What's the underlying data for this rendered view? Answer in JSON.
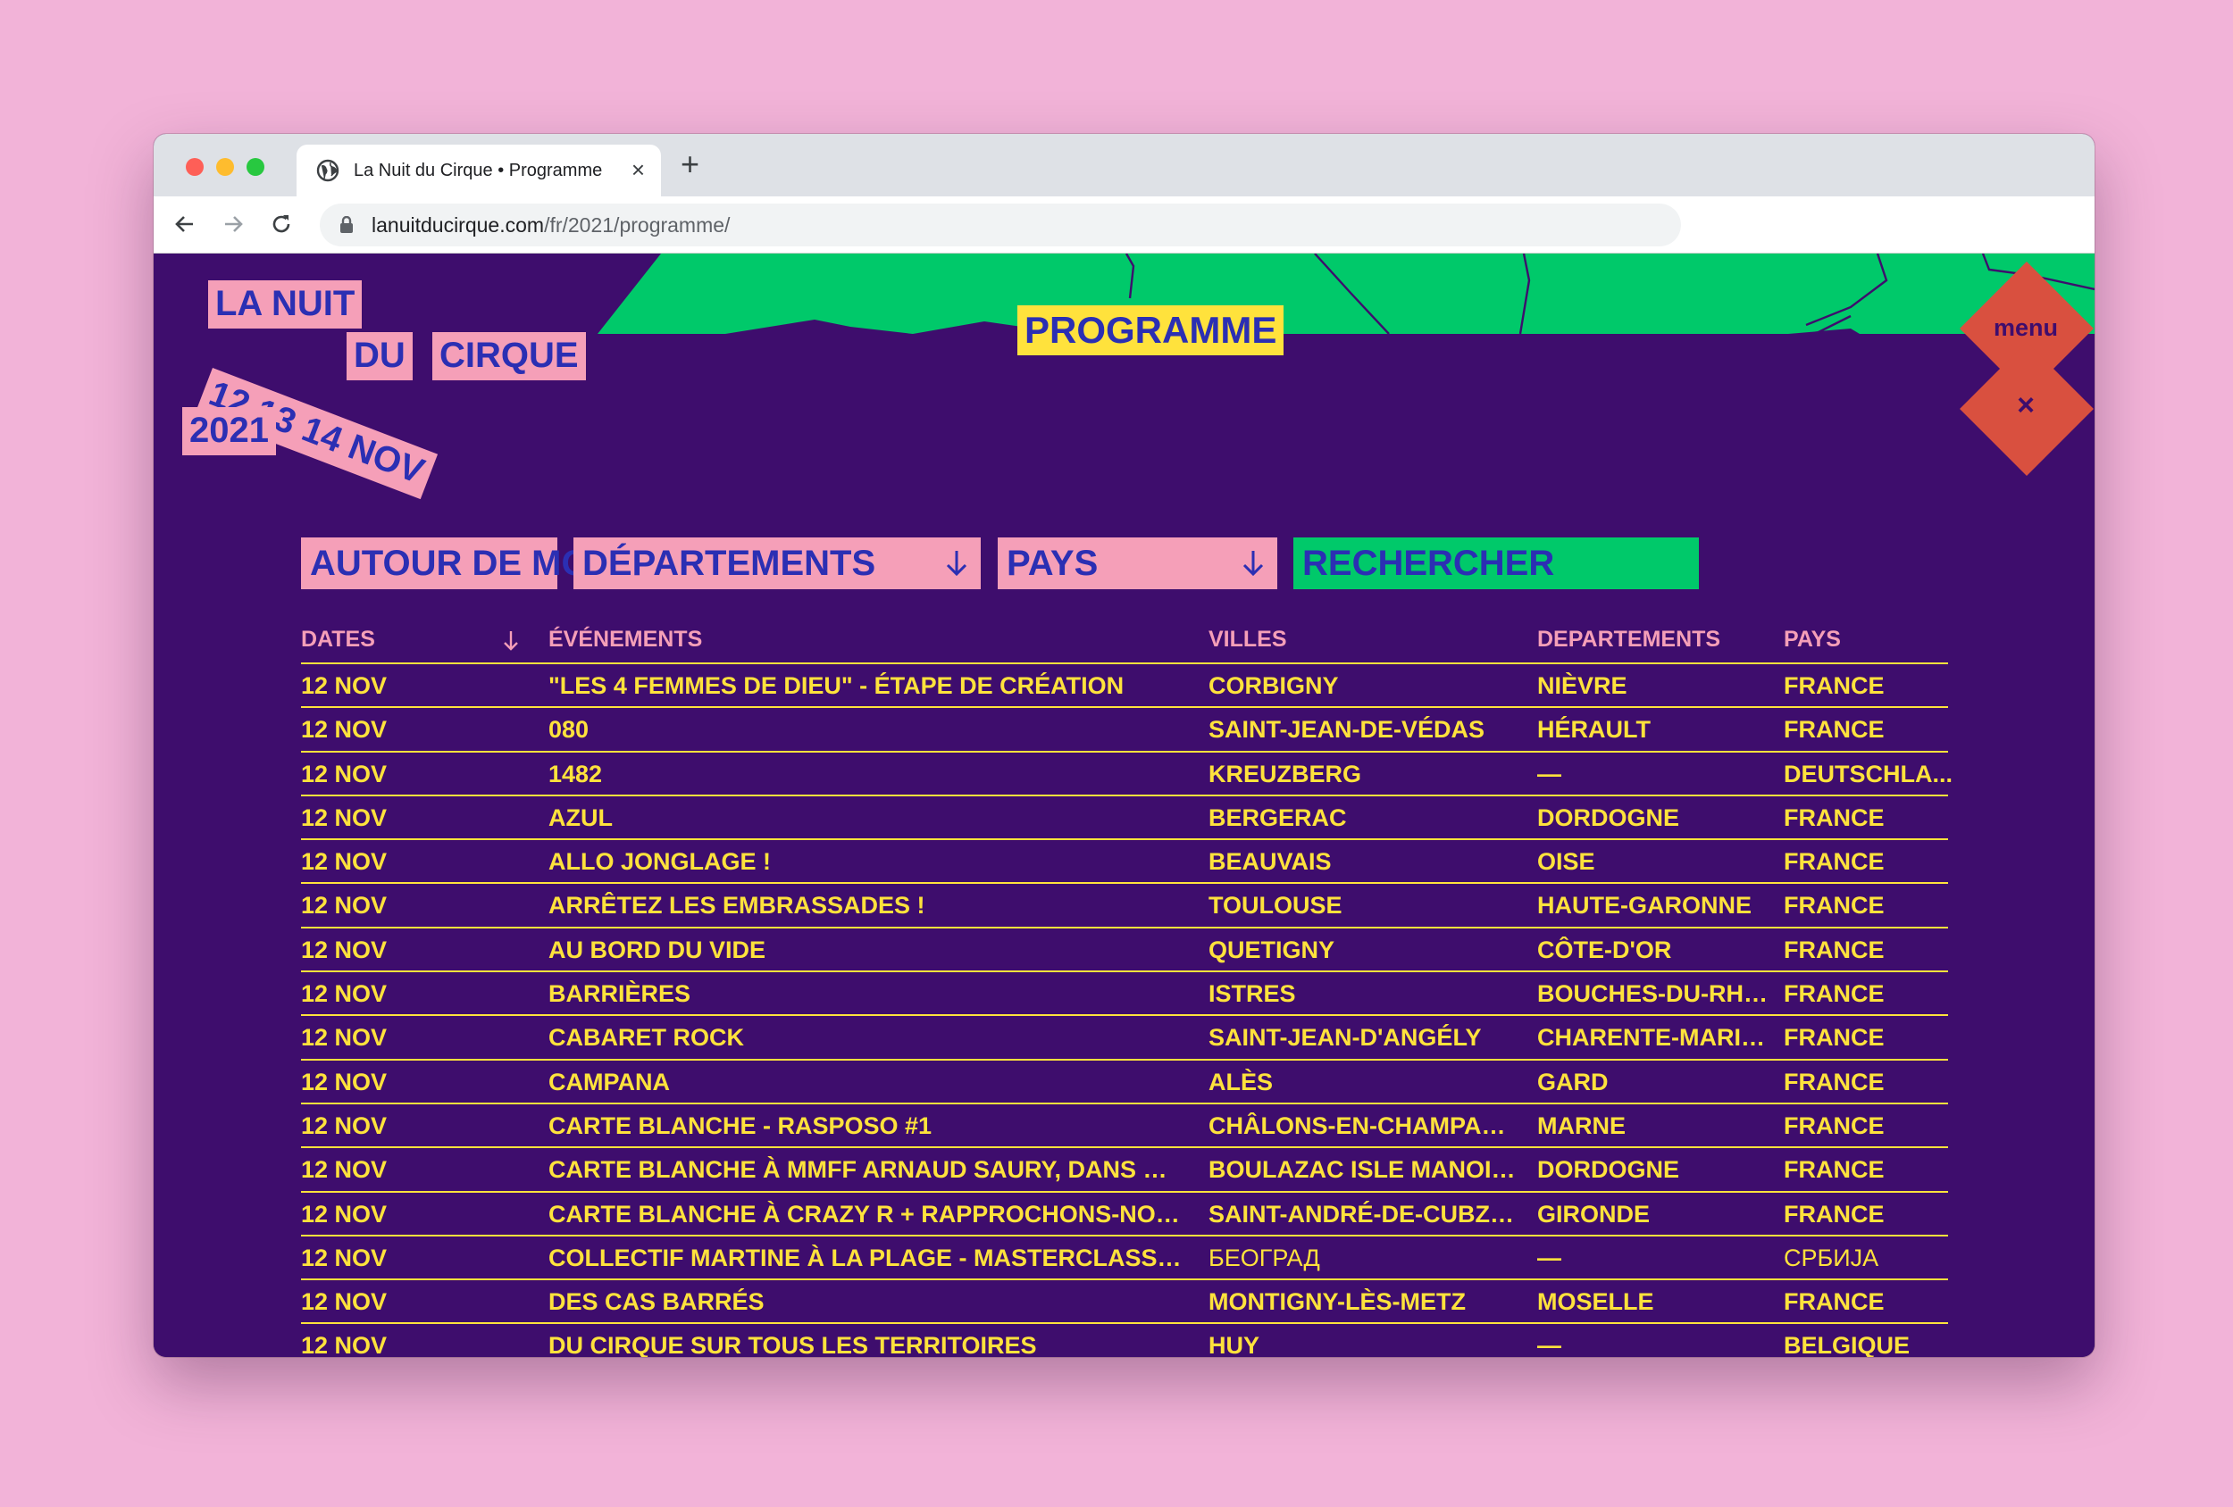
{
  "browser": {
    "tab_title": "La Nuit du Cirque • Programme",
    "tab_close": "×",
    "new_tab": "+",
    "url_host": "lanuitducirque.com",
    "url_path": "/fr/2021/programme/"
  },
  "logo": {
    "line1": "LA NUIT",
    "du": "DU",
    "cirque": "CIRQUE",
    "dates": "12 13 14 NOV",
    "year": "2021"
  },
  "page": {
    "section_label": "PROGRAMME",
    "menu_label": "menu",
    "close_label": "×"
  },
  "colors": {
    "background": "#3e0d6d",
    "pink": "#f59fb8",
    "yellow": "#ffe23c",
    "green": "#00c96a",
    "red": "#d9503f",
    "blue_text": "#2b2fb3"
  },
  "filters": {
    "around_me": "AUTOUR DE MOI",
    "departments": "DÉPARTEMENTS",
    "countries": "PAYS",
    "search": "RECHERCHER"
  },
  "table": {
    "headers": {
      "dates": "DATES",
      "events": "ÉVÉNEMENTS",
      "cities": "VILLES",
      "departments": "DEPARTEMENTS",
      "countries": "PAYS"
    },
    "rows": [
      {
        "date": "12 NOV",
        "event": "\"LES 4 FEMMES DE DIEU\" - ÉTAPE DE CRÉATION",
        "city": "CORBIGNY",
        "dept": "NIÈVRE",
        "country": "FRANCE"
      },
      {
        "date": "12 NOV",
        "event": "080",
        "city": "SAINT-JEAN-DE-VÉDAS",
        "dept": "HÉRAULT",
        "country": "FRANCE"
      },
      {
        "date": "12 NOV",
        "event": "1482",
        "city": "KREUZBERG",
        "dept": "—",
        "country": "DEUTSCHLA..."
      },
      {
        "date": "12 NOV",
        "event": "AZUL",
        "city": "BERGERAC",
        "dept": "DORDOGNE",
        "country": "FRANCE"
      },
      {
        "date": "12 NOV",
        "event": "ALLO JONGLAGE !",
        "city": "BEAUVAIS",
        "dept": "OISE",
        "country": "FRANCE"
      },
      {
        "date": "12 NOV",
        "event": "ARRÊTEZ LES EMBRASSADES !",
        "city": "TOULOUSE",
        "dept": "HAUTE-GARONNE",
        "country": "FRANCE"
      },
      {
        "date": "12 NOV",
        "event": "AU BORD DU VIDE",
        "city": "QUETIGNY",
        "dept": "CÔTE-D'OR",
        "country": "FRANCE"
      },
      {
        "date": "12 NOV",
        "event": "BARRIÈRES",
        "city": "ISTRES",
        "dept": "BOUCHES-DU-RHÔNE",
        "country": "FRANCE"
      },
      {
        "date": "12 NOV",
        "event": "CABARET ROCK",
        "city": "SAINT-JEAN-D'ANGÉLY",
        "dept": "CHARENTE-MARITIME",
        "country": "FRANCE"
      },
      {
        "date": "12 NOV",
        "event": "CAMPANA",
        "city": "ALÈS",
        "dept": "GARD",
        "country": "FRANCE"
      },
      {
        "date": "12 NOV",
        "event": "CARTE BLANCHE - RASPOSO #1",
        "city": "CHÂLONS-EN-CHAMPAGNE",
        "dept": "MARNE",
        "country": "FRANCE"
      },
      {
        "date": "12 NOV",
        "event": "CARTE BLANCHE À MMFF ARNAUD SAURY, DANS MA CHAMBRE -...",
        "city": "BOULAZAC ISLE MANOIRE",
        "dept": "DORDOGNE",
        "country": "FRANCE"
      },
      {
        "date": "12 NOV",
        "event": "CARTE BLANCHE À CRAZY R + RAPPROCHONS-NOUS PAR LA M...",
        "city": "SAINT-ANDRÉ-DE-CUBZAC",
        "dept": "GIRONDE",
        "country": "FRANCE"
      },
      {
        "date": "12 NOV",
        "event": "COLLECTIF MARTINE À LA PLAGE - MASTERCLASS / BELGRADE",
        "city": "БЕОГРАД",
        "dept": "—",
        "country": "СРБИЈА"
      },
      {
        "date": "12 NOV",
        "event": "DES CAS BARRÉS",
        "city": "MONTIGNY-LÈS-METZ",
        "dept": "MOSELLE",
        "country": "FRANCE"
      },
      {
        "date": "12 NOV",
        "event": "DU CIRQUE SUR TOUS LES TERRITOIRES",
        "city": "HUY",
        "dept": "—",
        "country": "BELGIQUE"
      }
    ]
  }
}
